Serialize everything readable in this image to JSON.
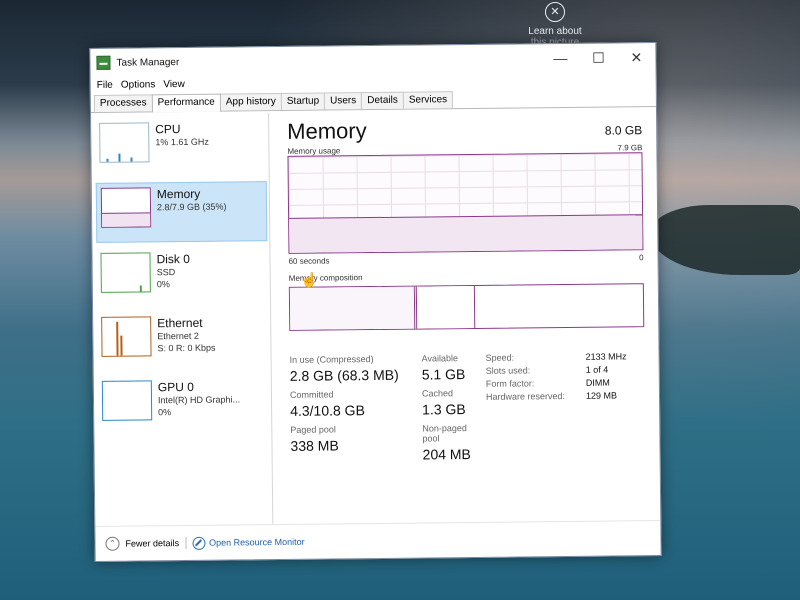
{
  "desktop": {
    "learn_label": "Learn about",
    "learn_sub": "this picture"
  },
  "window": {
    "title": "Task Manager",
    "minimize": "—",
    "maximize": "☐",
    "close": "✕"
  },
  "menu": [
    "File",
    "Options",
    "View"
  ],
  "tabs": [
    "Processes",
    "Performance",
    "App history",
    "Startup",
    "Users",
    "Details",
    "Services"
  ],
  "active_tab": "Performance",
  "sidebar": [
    {
      "name": "CPU",
      "line1": "1% 1.61 GHz",
      "line2": ""
    },
    {
      "name": "Memory",
      "line1": "2.8/7.9 GB (35%)",
      "line2": ""
    },
    {
      "name": "Disk 0",
      "line1": "SSD",
      "line2": "0%"
    },
    {
      "name": "Ethernet",
      "line1": "Ethernet 2",
      "line2": "S: 0 R: 0 Kbps"
    },
    {
      "name": "GPU 0",
      "line1": "Intel(R) HD Graphi...",
      "line2": "0%"
    }
  ],
  "memory": {
    "title": "Memory",
    "total": "8.0 GB",
    "usage_label": "Memory usage",
    "usage_max": "7.9 GB",
    "usage_fraction": 0.35,
    "x_left": "60 seconds",
    "x_right": "0",
    "composition_label": "Memory composition",
    "stats": {
      "in_use_label": "In use (Compressed)",
      "in_use": "2.8 GB (68.3 MB)",
      "available_label": "Available",
      "available": "5.1 GB",
      "committed_label": "Committed",
      "committed": "4.3/10.8 GB",
      "cached_label": "Cached",
      "cached": "1.3 GB",
      "paged_label": "Paged pool",
      "paged": "338 MB",
      "nonpaged_label": "Non-paged pool",
      "nonpaged": "204 MB"
    },
    "details": [
      {
        "k": "Speed:",
        "v": "2133 MHz"
      },
      {
        "k": "Slots used:",
        "v": "1 of 4"
      },
      {
        "k": "Form factor:",
        "v": "DIMM"
      },
      {
        "k": "Hardware reserved:",
        "v": "129 MB"
      }
    ]
  },
  "footer": {
    "fewer": "Fewer details",
    "monitor": "Open Resource Monitor"
  },
  "colors": {
    "memory_accent": "#8b3a8b",
    "selected_bg": "#cce4f7",
    "link": "#1e5ea8"
  }
}
